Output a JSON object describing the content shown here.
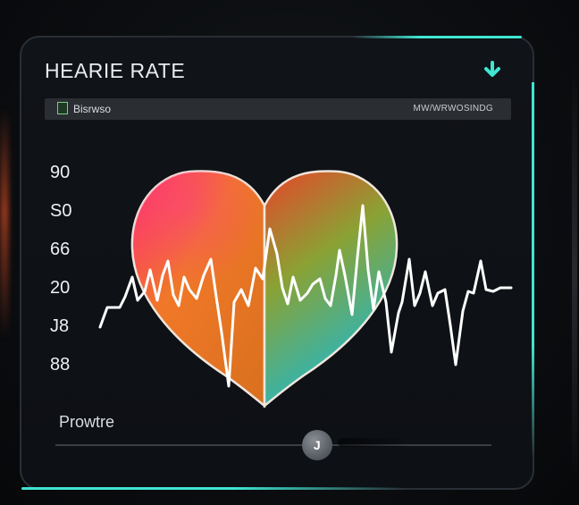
{
  "widget": {
    "title": "HEARIE RATE",
    "subheader_left": "Bisrwso",
    "subheader_right": "MW/WRWOSINDG",
    "y_axis_labels": [
      "90",
      "S0",
      "66",
      "20",
      "J8",
      "88"
    ],
    "footer_label": "Prowtre",
    "slider_glyph": "J",
    "slider_value_fraction": 0.6
  },
  "icons": {
    "download": "arrow-down-icon",
    "subheader": "square-icon",
    "heart": "heart-icon"
  },
  "colors": {
    "accent": "#3fe6d2",
    "background": "#0d1014",
    "trace": "#ffffff",
    "heart_top_left": "#ff2f6e",
    "heart_left": "#f07828",
    "heart_right": "#6fae3a",
    "heart_bottom": "#2ab6c2"
  }
}
